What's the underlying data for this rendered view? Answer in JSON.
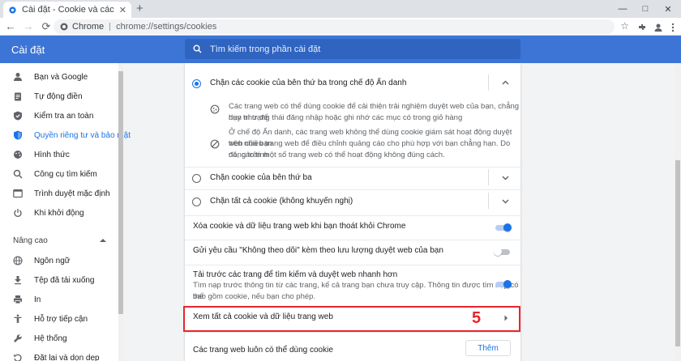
{
  "tab": {
    "title": "Cài đặt - Cookie và các dữ liệu k",
    "close": "✕",
    "new": "+"
  },
  "window_controls": {
    "minimize": "—",
    "maximize": "□",
    "close": "✕"
  },
  "toolbar": {
    "back": "←",
    "forward": "→",
    "reload": "⟳"
  },
  "omnibox": {
    "chip": "Chrome",
    "url": "chrome://settings/cookies",
    "star": "☆"
  },
  "settings": {
    "title": "Cài đặt",
    "search_placeholder": "Tìm kiếm trong phần cài đặt"
  },
  "sidebar": {
    "items": [
      {
        "label": "Bạn và Google",
        "icon": "person-icon"
      },
      {
        "label": "Tự động điền",
        "icon": "clipboard-icon"
      },
      {
        "label": "Kiểm tra an toàn",
        "icon": "shield-check-icon"
      },
      {
        "label": "Quyền riêng tư và bảo mật",
        "icon": "shield-icon",
        "active": true
      },
      {
        "label": "Hình thức",
        "icon": "palette-icon"
      },
      {
        "label": "Công cụ tìm kiếm",
        "icon": "search-icon"
      },
      {
        "label": "Trình duyệt mặc định",
        "icon": "browser-icon"
      },
      {
        "label": "Khi khởi động",
        "icon": "power-icon"
      }
    ],
    "advanced": "Nâng cao",
    "advanced_items": [
      {
        "label": "Ngôn ngữ",
        "icon": "globe-icon"
      },
      {
        "label": "Tệp đã tải xuống",
        "icon": "download-icon"
      },
      {
        "label": "In",
        "icon": "printer-icon"
      },
      {
        "label": "Hỗ trợ tiếp cận",
        "icon": "accessibility-icon"
      },
      {
        "label": "Hệ thống",
        "icon": "wrench-icon"
      },
      {
        "label": "Đặt lại và dọn dẹp",
        "icon": "reset-icon"
      }
    ]
  },
  "cookies": {
    "option1": "Chặn các cookie của bên thứ ba trong chế độ Ẩn danh",
    "option1_desc1_line1": "Các trang web có thể dùng cookie để cải thiện trải nghiệm duyệt web của bạn, chẳng hạn như để",
    "option1_desc1_line2": "duy trì trạng thái đăng nhập hoặc ghi nhớ các mục có trong giỏ hàng",
    "option1_desc2_line1": "Ở chế độ Ẩn danh, các trang web không thể dùng cookie giám sát hoạt động duyệt web của bạn",
    "option1_desc2_line2": "trên nhiều trang web để điều chỉnh quảng cáo cho phù hợp với bạn chẳng hạn. Do đó, các tính",
    "option1_desc2_line3": "năng trên một số trang web có thể hoạt động không đúng cách.",
    "option2": "Chặn cookie của bên thứ ba",
    "option3": "Chặn tất cả cookie (không khuyến nghị)",
    "clear_on_exit": "Xóa cookie và dữ liệu trang web khi bạn thoát khỏi Chrome",
    "do_not_track": "Gửi yêu cầu \"Không theo dõi\" kèm theo lưu lượng duyệt web của bạn",
    "preload_title": "Tải trước các trang để tìm kiếm và duyệt web nhanh hơn",
    "preload_desc_line1": "Tìm nạp trước thông tin từ các trang, kể cả trang bạn chưa truy cập. Thông tin được tìm nạp có thể",
    "preload_desc_line2": "bao gồm cookie, nếu bạn cho phép.",
    "see_all": "Xem tất cả cookie và dữ liệu trang web",
    "always_allow": "Các trang web luôn có thể dùng cookie",
    "add_button": "Thêm",
    "toggles": {
      "clear_on_exit": true,
      "do_not_track": false,
      "preload": true
    }
  },
  "annotation": {
    "step": "5",
    "color": "#e8262b"
  },
  "colors": {
    "accent": "#1a73e8",
    "header": "#3c75d6"
  }
}
